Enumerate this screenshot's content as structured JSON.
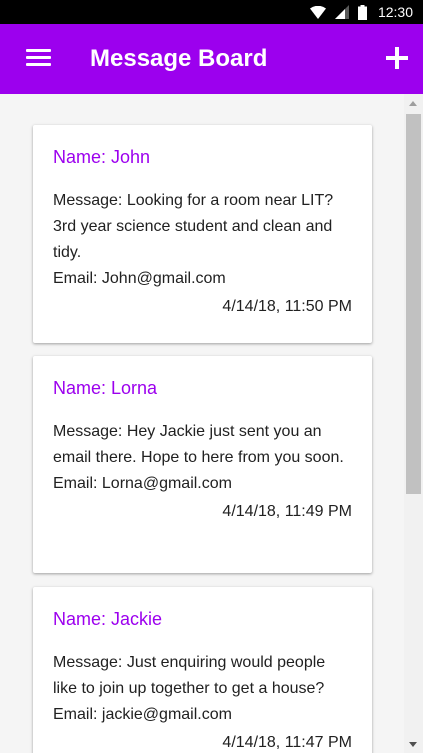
{
  "status_bar": {
    "time": "12:30",
    "icons": [
      "wifi-icon",
      "signal-icon",
      "battery-icon"
    ]
  },
  "toolbar": {
    "title": "Message Board",
    "menu_icon": "menu-icon",
    "add_icon": "add-icon"
  },
  "colors": {
    "accent": "#9c00ee",
    "status_bar": "#000000",
    "background": "#f5f5f5",
    "card": "#ffffff"
  },
  "messages": [
    {
      "name": "Name: John",
      "message": "Message: Looking for a room near LIT? 3rd year science student and clean and tidy.",
      "email": "Email: John@gmail.com",
      "date": "4/14/18, 11:50 PM"
    },
    {
      "name": "Name: Lorna",
      "message": "Message: Hey Jackie just sent you an email there. Hope to here from you soon.",
      "email": "Email: Lorna@gmail.com",
      "date": "4/14/18, 11:49 PM"
    },
    {
      "name": "Name: Jackie",
      "message": "Message: Just enquiring would people like to join up together to get a house?",
      "email": "Email: jackie@gmail.com",
      "date": "4/14/18, 11:47 PM"
    }
  ]
}
